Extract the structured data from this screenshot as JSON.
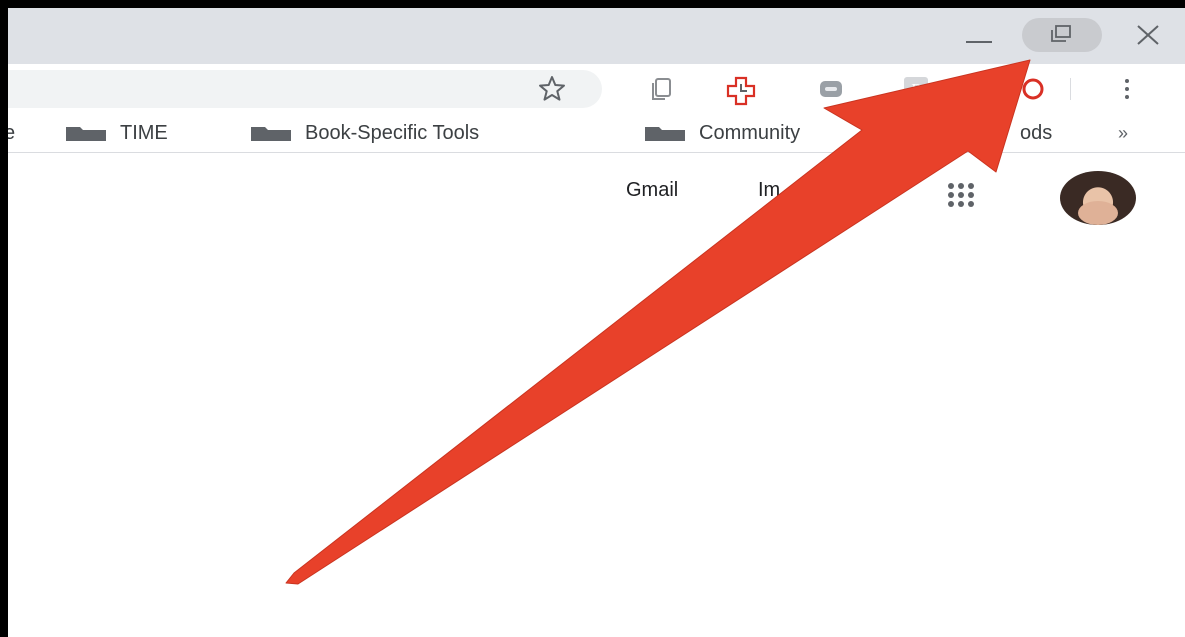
{
  "window_controls": {
    "minimize_icon": "minimize-icon",
    "restore_icon": "restore-down-icon",
    "close_icon": "close-icon"
  },
  "toolbar": {
    "bookmark_icon": "star-icon",
    "extensions": [
      "copy-extension-icon",
      "red-cross-extension-icon",
      "gray-extension-icon",
      "r-extension-icon",
      "red-extension-icon"
    ],
    "menu_icon": "three-dots-vertical-icon"
  },
  "bookmarks": {
    "partial_left": "e",
    "items": [
      {
        "label": "TIME"
      },
      {
        "label": "Book-Specific Tools"
      },
      {
        "label": "Community"
      }
    ],
    "partial_item": "ods",
    "more_label": "»"
  },
  "google_header": {
    "gmail": "Gmail",
    "images_partial": "Im",
    "apps_icon": "apps-grid-icon"
  },
  "colors": {
    "arrow": "#e8412a",
    "titlebar": "#dee1e6",
    "omnibox": "#f1f3f4"
  }
}
